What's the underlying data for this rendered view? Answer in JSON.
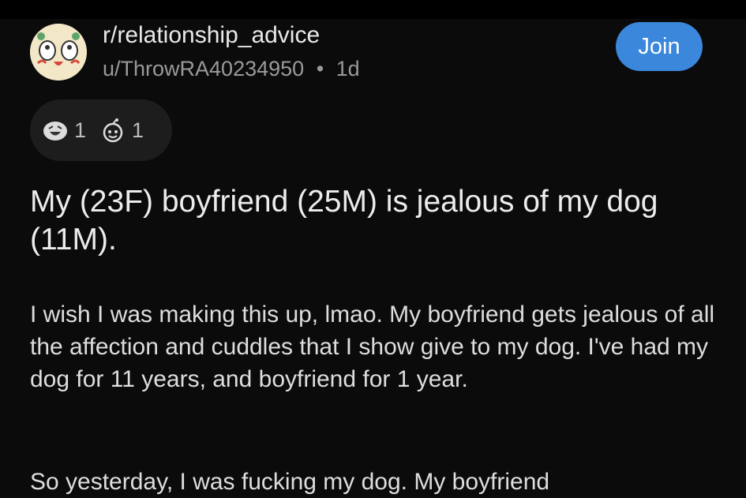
{
  "post": {
    "subreddit": "r/relationship_advice",
    "author": "u/ThrowRA40234950",
    "separator": "•",
    "age": "1d",
    "join_label": "Join",
    "awards": [
      {
        "icon": "laughing-face-icon",
        "count": "1"
      },
      {
        "icon": "snoo-award-icon",
        "count": "1"
      }
    ],
    "title": "My (23F) boyfriend (25M) is jealous of my dog (11M).",
    "body_paragraph_1": "I wish I was making this up, lmao. My boyfriend gets jealous of all the affection and cuddles that I show give to my dog. I've had my dog for 11 years, and boyfriend for 1 year.",
    "body_paragraph_2_partial": "So yesterday, I was fucking my dog. My boyfriend"
  },
  "colors": {
    "background": "#0b0b0b",
    "join_button": "#3a87db",
    "award_pill": "#1d1d1d"
  }
}
